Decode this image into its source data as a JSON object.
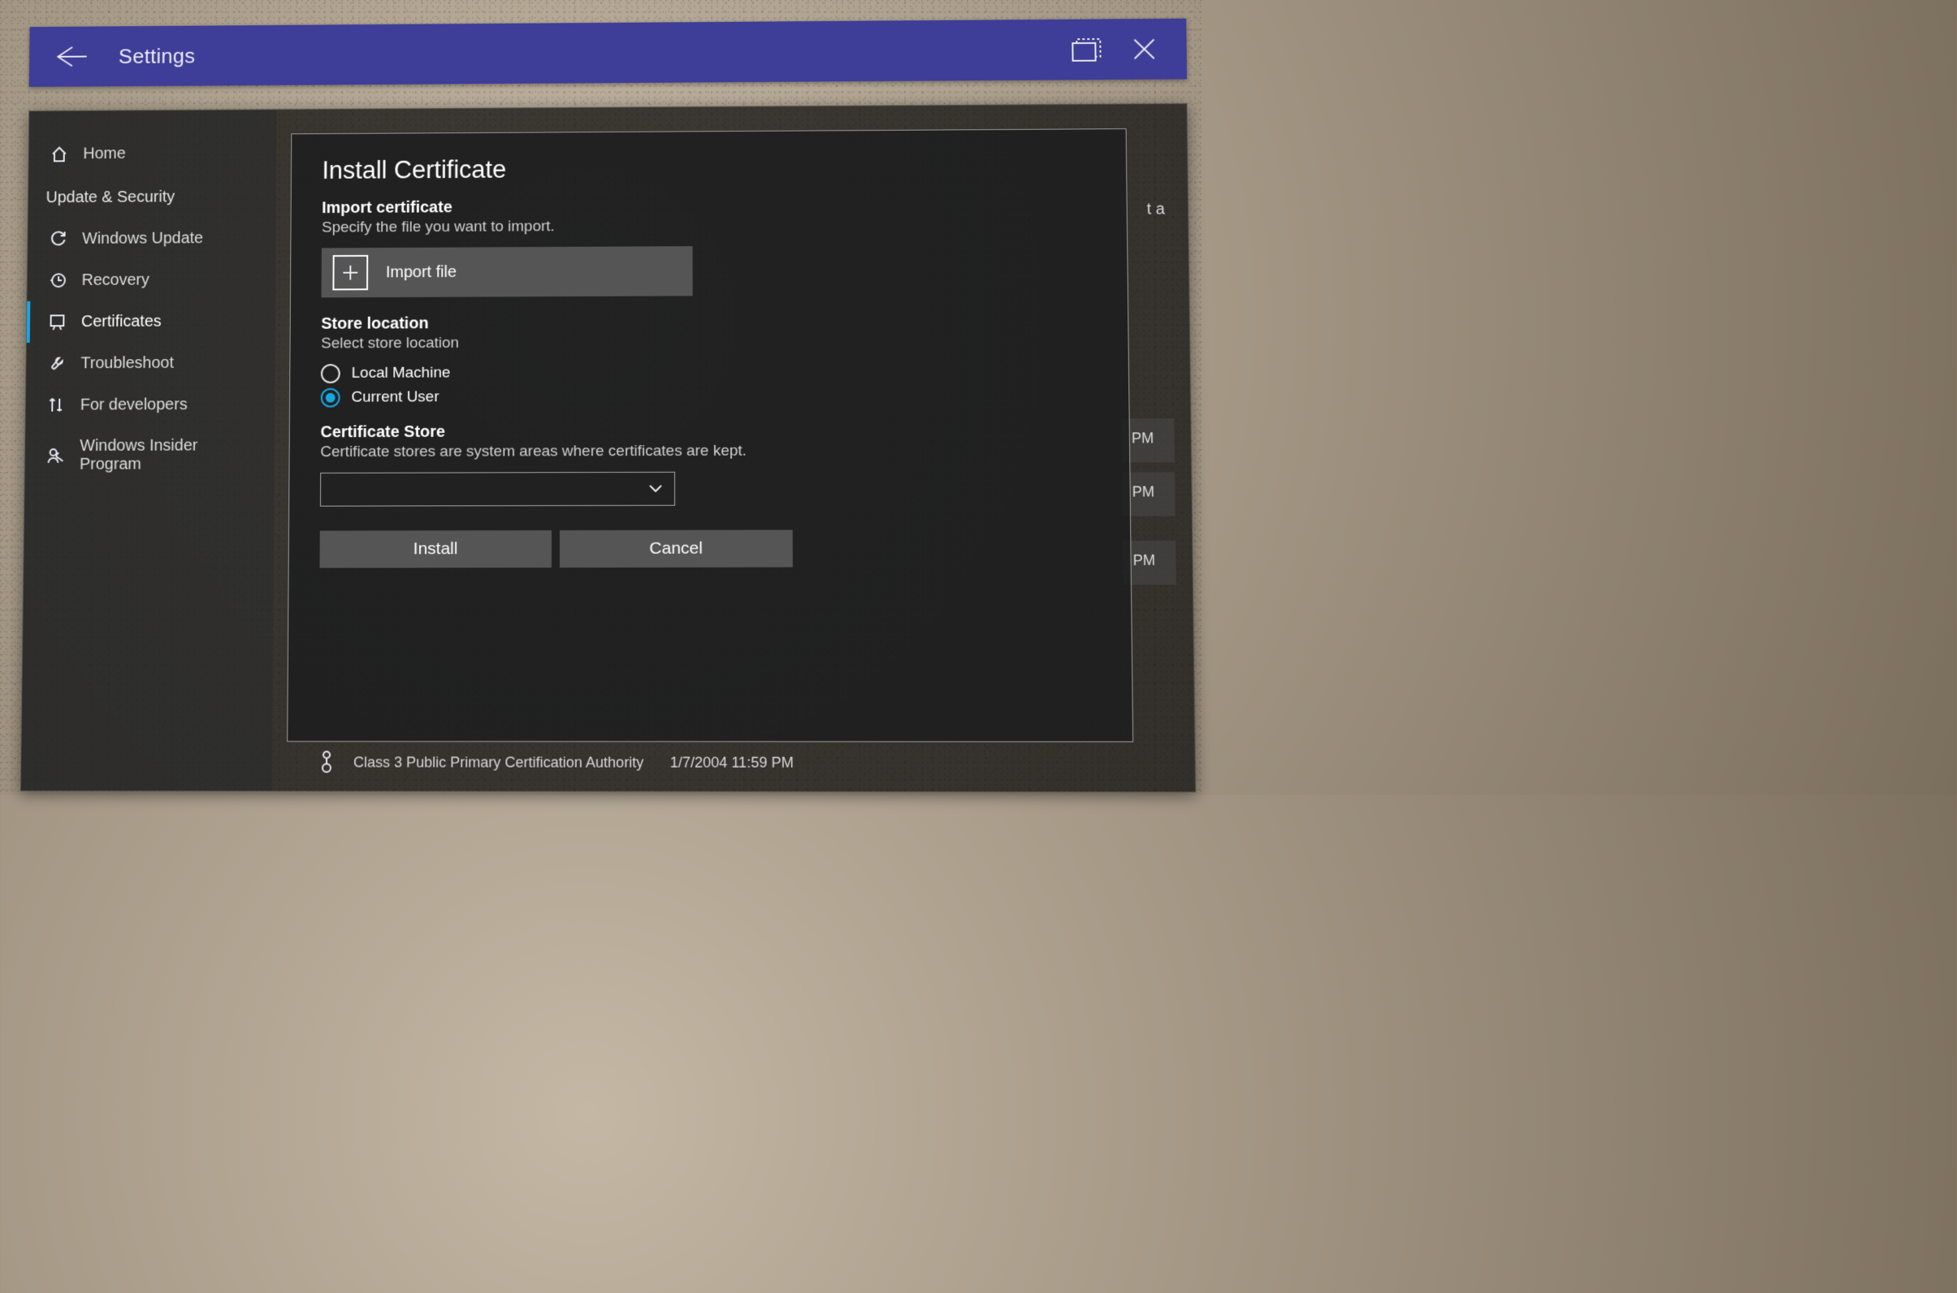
{
  "titlebar": {
    "title": "Settings"
  },
  "sidebar": {
    "home": "Home",
    "section": "Update & Security",
    "items": [
      {
        "label": "Windows Update"
      },
      {
        "label": "Recovery"
      },
      {
        "label": "Certificates"
      },
      {
        "label": "Troubleshoot"
      },
      {
        "label": "For developers"
      },
      {
        "label": "Windows Insider Program"
      }
    ]
  },
  "modal": {
    "title": "Install Certificate",
    "import_label": "Import certificate",
    "import_desc": "Specify the file you want to import.",
    "import_btn": "Import file",
    "store_label": "Store location",
    "store_desc": "Select store location",
    "radio_local": "Local Machine",
    "radio_user": "Current User",
    "certstore_label": "Certificate Store",
    "certstore_desc": "Certificate stores are system areas where certificates are kept.",
    "install": "Install",
    "cancel": "Cancel"
  },
  "bg": {
    "t_a": "t a",
    "pm1": "PM",
    "pm2": "PM",
    "pm3": "PM",
    "cert_label": "Class 3 Public Primary Certification Authority",
    "cert_date": "1/7/2004 11:59 PM"
  }
}
